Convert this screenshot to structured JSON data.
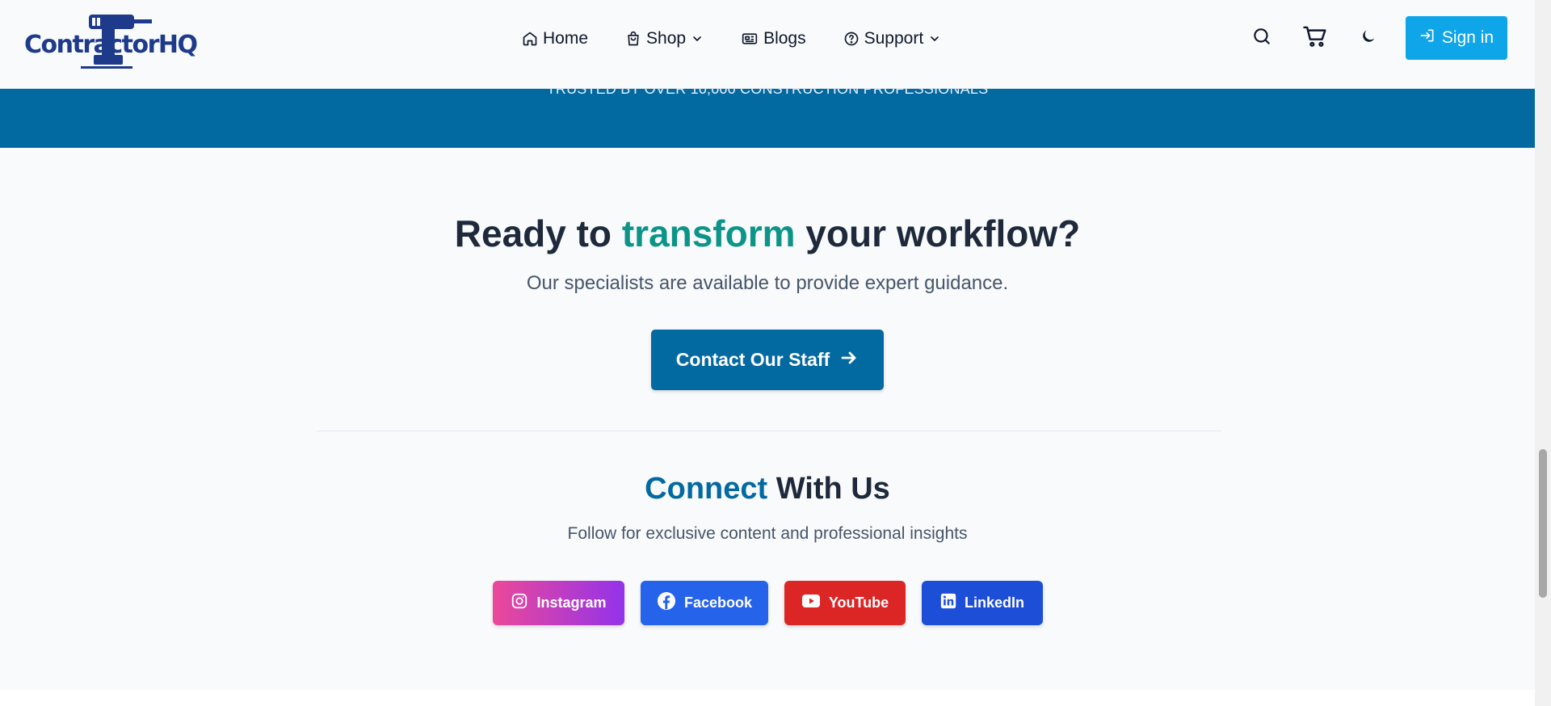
{
  "header": {
    "logo_text": "ContractorHQ",
    "nav": [
      {
        "label": "Home",
        "icon": "home-icon"
      },
      {
        "label": "Shop",
        "icon": "shopping-bag-icon",
        "dropdown": true
      },
      {
        "label": "Blogs",
        "icon": "newspaper-icon"
      },
      {
        "label": "Support",
        "icon": "help-circle-icon",
        "dropdown": true
      }
    ],
    "signin_label": "Sign in"
  },
  "banner": {
    "text": "TRUSTED BY OVER 10,000 CONSTRUCTION PROFESSIONALS"
  },
  "cta": {
    "title_before": "Ready to ",
    "title_accent": "transform",
    "title_after": " your workflow?",
    "subtitle": "Our specialists are available to provide expert guidance.",
    "button_label": "Contact Our Staff"
  },
  "connect": {
    "title_accent": "Connect",
    "title_after": " With Us",
    "subtitle": "Follow for exclusive content and professional insights",
    "socials": [
      {
        "label": "Instagram",
        "icon": "instagram-icon",
        "color": "#db2777"
      },
      {
        "label": "Facebook",
        "icon": "facebook-icon",
        "color": "#2563eb"
      },
      {
        "label": "YouTube",
        "icon": "youtube-icon",
        "color": "#dc2626"
      },
      {
        "label": "LinkedIn",
        "icon": "linkedin-icon",
        "color": "#1d4ed8"
      }
    ]
  },
  "colors": {
    "primary": "#0369a1",
    "accent_teal": "#0d9488",
    "signin": "#0ea5e9"
  }
}
